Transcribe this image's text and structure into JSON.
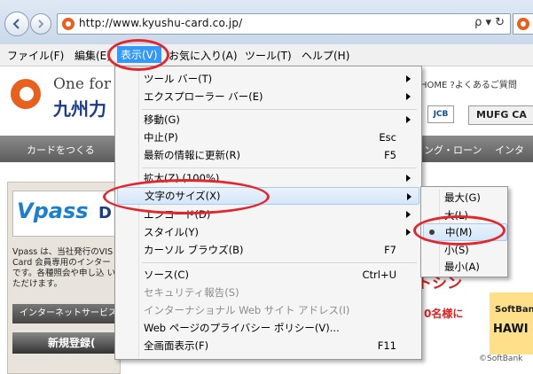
{
  "browser": {
    "url": "http://www.kyushu-card.co.jp/",
    "url_icons": "ρ ▾ ↻"
  },
  "menubar": {
    "items": [
      "ファイル(F)",
      "編集(E)",
      "表示(V)",
      "お気に入り(A)",
      "ツール(T)",
      "ヘルプ(H)"
    ],
    "active": "表示(V)"
  },
  "page": {
    "logo_line1": "One for",
    "logo_line2": "九州力",
    "header_links": "HOME ?よくあるご質問",
    "card_jcb": "JCB",
    "card_mufg": "MUFG CA",
    "nav": [
      "カードをつくる",
      "ング・ローン",
      "インター"
    ],
    "vpass_logo": "Vpass",
    "vpass_suffix": "D",
    "vpass_text": "Vpass は、当社発行のVIS Card 会員専用のインター です。各種照会や申し込 いただけます。",
    "internet_button": "インターネットサービス",
    "register_button": "新規登録(",
    "promo1": "トシン",
    "promo2": "0名様に",
    "hawks_line1": "SoftBan",
    "hawks_line2": "HAWI",
    "credit": "©SoftBank"
  },
  "view_menu": {
    "items": [
      {
        "label": "ツール バー(T)",
        "shortcut": "",
        "submenu": true,
        "disabled": false
      },
      {
        "label": "エクスプローラー バー(E)",
        "shortcut": "",
        "submenu": true,
        "disabled": false
      },
      {
        "label": "移動(G)",
        "shortcut": "",
        "submenu": true,
        "disabled": false
      },
      {
        "label": "中止(P)",
        "shortcut": "Esc",
        "submenu": false,
        "disabled": false
      },
      {
        "label": "最新の情報に更新(R)",
        "shortcut": "F5",
        "submenu": false,
        "disabled": false
      },
      {
        "label": "拡大(Z) (100%)",
        "shortcut": "",
        "submenu": true,
        "disabled": false
      },
      {
        "label": "文字のサイズ(X)",
        "shortcut": "",
        "submenu": true,
        "disabled": false,
        "highlighted": true
      },
      {
        "label": "エンコード(D)",
        "shortcut": "",
        "submenu": true,
        "disabled": false
      },
      {
        "label": "スタイル(Y)",
        "shortcut": "",
        "submenu": true,
        "disabled": false
      },
      {
        "label": "カーソル ブラウズ(B)",
        "shortcut": "F7",
        "submenu": false,
        "disabled": false
      },
      {
        "label": "ソース(C)",
        "shortcut": "Ctrl+U",
        "submenu": false,
        "disabled": false
      },
      {
        "label": "セキュリティ報告(S)",
        "shortcut": "",
        "submenu": false,
        "disabled": true
      },
      {
        "label": "インターナショナル Web サイト アドレス(I)",
        "shortcut": "",
        "submenu": false,
        "disabled": true
      },
      {
        "label": "Web ページのプライバシー ポリシー(V)...",
        "shortcut": "",
        "submenu": false,
        "disabled": false
      },
      {
        "label": "全画面表示(F)",
        "shortcut": "F11",
        "submenu": false,
        "disabled": false
      }
    ]
  },
  "text_size_submenu": {
    "items": [
      "最大(G)",
      "大(L)",
      "中(M)",
      "小(S)",
      "最小(A)"
    ],
    "selected": "中(M)"
  },
  "colors": {
    "highlight_ellipse": "#e3262c",
    "menu_active": "#3399ff",
    "brand_orange": "#e8601c"
  }
}
